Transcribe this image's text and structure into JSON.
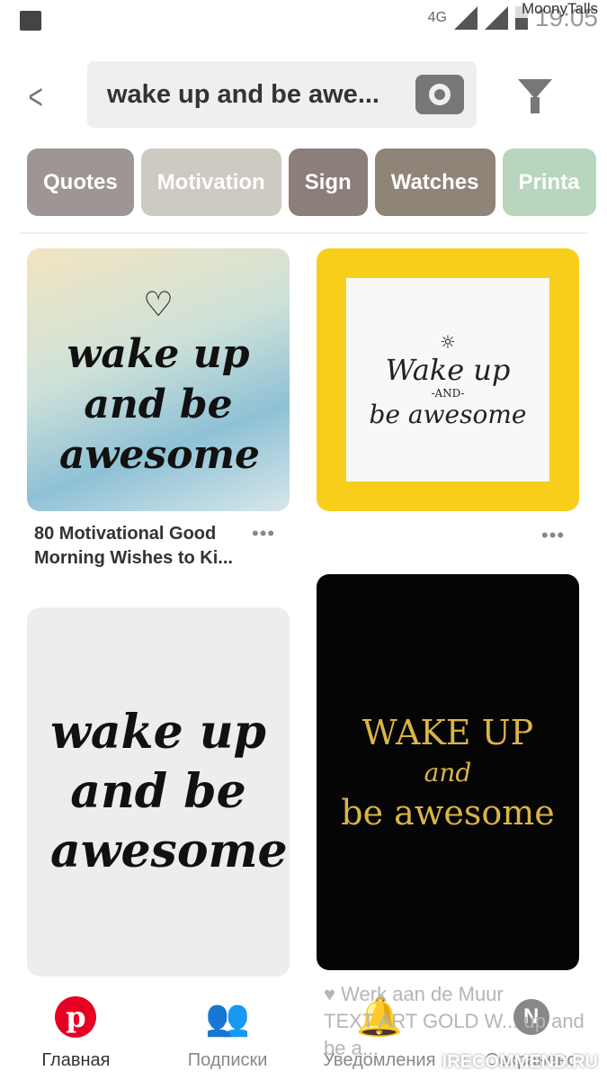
{
  "status": {
    "network": "4G",
    "time": "19:05",
    "username": "MoonyTalls"
  },
  "search": {
    "query": "wake up and be awe..."
  },
  "chips": [
    {
      "label": "Quotes",
      "color": "#9e9694"
    },
    {
      "label": "Motivation",
      "color": "#cdcac1"
    },
    {
      "label": "Sign",
      "color": "#8c7e7a"
    },
    {
      "label": "Watches",
      "color": "#8f8478"
    },
    {
      "label": "Printa",
      "color": "#b7d6bd"
    }
  ],
  "pins": [
    {
      "art": "wake up and be awesome",
      "caption": "80 Motivational Good Morning Wishes to Ki..."
    },
    {
      "art_line1": "Wake up",
      "art_line2": "-AND-",
      "art_line3": "be awesome",
      "caption": ""
    },
    {
      "art": "wake up and be awesome"
    },
    {
      "art_line1": "WAKE UP",
      "art_line2": "and",
      "art_line3": "be awesome",
      "source": "♥ Werk aan de Muur",
      "caption": "TEXT ART GOLD W... up and be a..."
    }
  ],
  "nav": [
    {
      "label": "Главная",
      "icon": "pinterest-logo-icon"
    },
    {
      "label": "Подписки",
      "icon": "people-icon"
    },
    {
      "label": "Уведомления",
      "icon": "bell-icon"
    },
    {
      "label": "Сохранено",
      "icon": "avatar-n-icon",
      "avatar_letter": "N"
    }
  ],
  "watermark": "IRECOMMEND.RU",
  "colors": {
    "pinterest_red": "#e60023",
    "yellow_frame": "#f7cf1a",
    "gold": "#d9b447"
  }
}
